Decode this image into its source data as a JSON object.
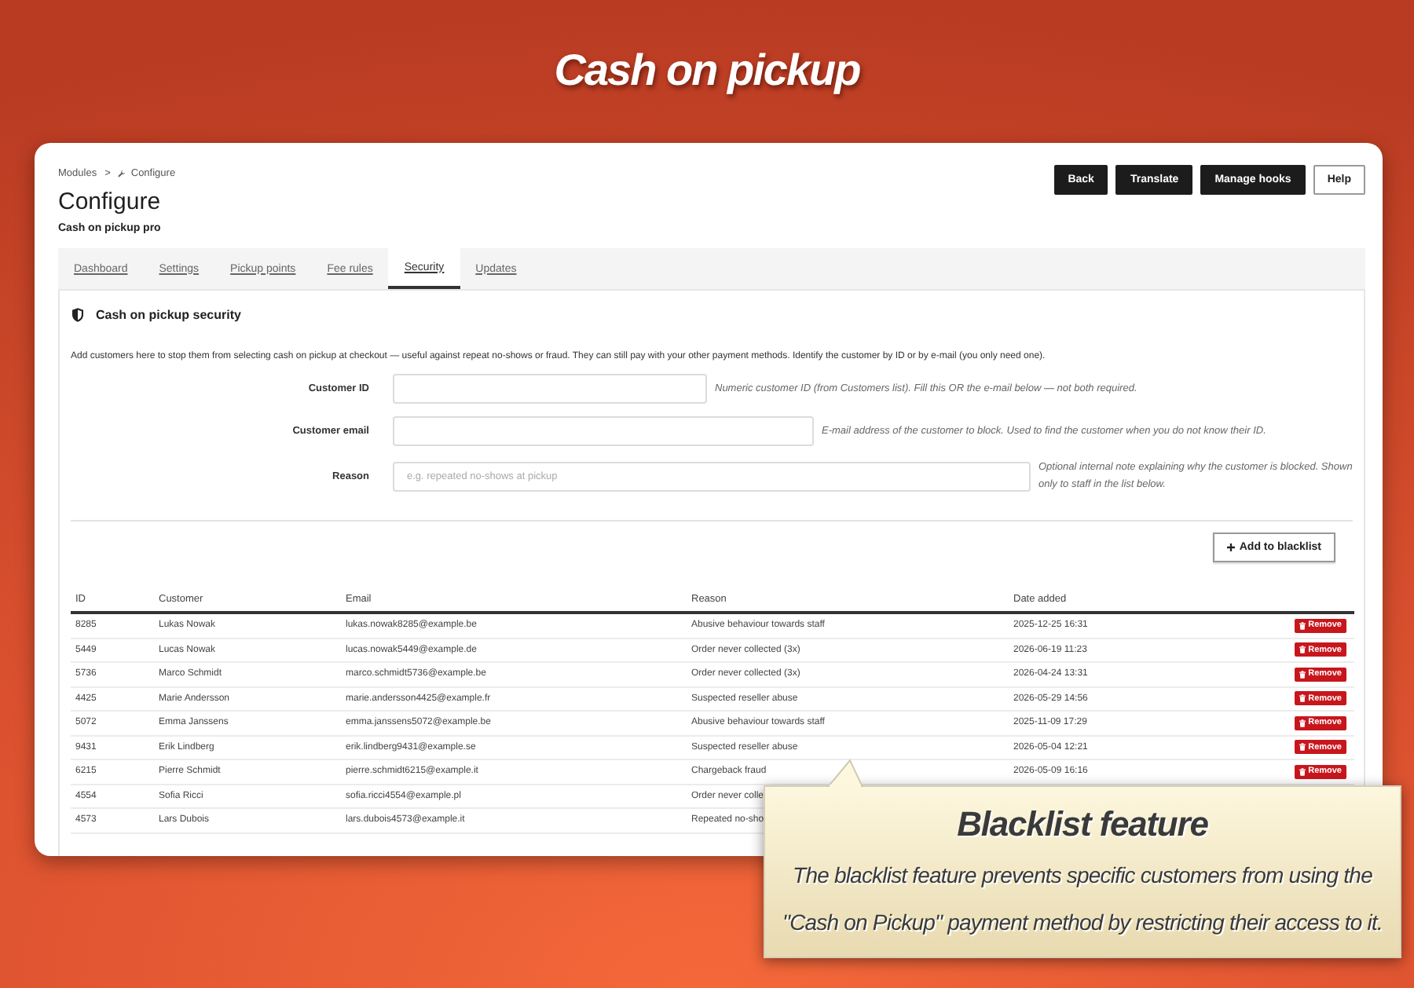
{
  "promo": {
    "title": "Cash on pickup"
  },
  "breadcrumb": {
    "items": [
      "Modules",
      "Configure"
    ],
    "separator": ">"
  },
  "page": {
    "title": "Configure",
    "subtitle": "Cash on pickup pro"
  },
  "header_buttons": [
    {
      "label": "Back",
      "kind": "dark"
    },
    {
      "label": "Translate",
      "kind": "dark"
    },
    {
      "label": "Manage hooks",
      "kind": "dark"
    },
    {
      "label": "Help",
      "kind": "outline"
    }
  ],
  "tabs": [
    {
      "label": "Dashboard",
      "selected": false
    },
    {
      "label": "Settings",
      "selected": false
    },
    {
      "label": "Pickup points",
      "selected": false
    },
    {
      "label": "Fee rules",
      "selected": false
    },
    {
      "label": "Security",
      "selected": true
    },
    {
      "label": "Updates",
      "selected": false
    }
  ],
  "panel": {
    "title": "Cash on pickup security",
    "description": "Add customers here to stop them from selecting cash on pickup at checkout — useful against repeat no-shows or fraud. They can still pay with your other payment methods. Identify the customer by ID or by e-mail (you only need one).",
    "fields": [
      {
        "label": "Customer ID",
        "help": "Numeric customer ID (from Customers list). Fill this OR the e-mail below — not both required."
      },
      {
        "label": "Customer email",
        "help": "E-mail address of the customer to block. Used to find the customer when you do not know their ID."
      },
      {
        "label": "Reason",
        "placeholder": "e.g. repeated no-shows at pickup",
        "help": "Optional internal note explaining why the customer is blocked. Shown only to staff in the list below."
      }
    ],
    "add_button": "Add to blacklist"
  },
  "table": {
    "columns": [
      "ID",
      "Customer",
      "Email",
      "Reason",
      "Date added"
    ],
    "rows": [
      {
        "id": "8285",
        "customer": "Lukas Nowak",
        "email": "lukas.nowak8285@example.be",
        "reason": "Abusive behaviour towards staff",
        "date_added": "2025-12-25 16:31",
        "action": "Remove"
      },
      {
        "id": "5449",
        "customer": "Lucas Nowak",
        "email": "lucas.nowak5449@example.de",
        "reason": "Order never collected (3x)",
        "date_added": "2026-06-19 11:23",
        "action": "Remove"
      },
      {
        "id": "5736",
        "customer": "Marco Schmidt",
        "email": "marco.schmidt5736@example.be",
        "reason": "Order never collected (3x)",
        "date_added": "2026-04-24 13:31",
        "action": "Remove"
      },
      {
        "id": "4425",
        "customer": "Marie Andersson",
        "email": "marie.andersson4425@example.fr",
        "reason": "Suspected reseller abuse",
        "date_added": "2026-05-29 14:56",
        "action": "Remove"
      },
      {
        "id": "5072",
        "customer": "Emma Janssens",
        "email": "emma.janssens5072@example.be",
        "reason": "Abusive behaviour towards staff",
        "date_added": "2025-11-09 17:29",
        "action": "Remove"
      },
      {
        "id": "9431",
        "customer": "Erik Lindberg",
        "email": "erik.lindberg9431@example.se",
        "reason": "Suspected reseller abuse",
        "date_added": "2026-05-04 12:21",
        "action": "Remove"
      },
      {
        "id": "6215",
        "customer": "Pierre Schmidt",
        "email": "pierre.schmidt6215@example.it",
        "reason": "Chargeback fraud",
        "date_added": "2026-05-09 16:16",
        "action": "Remove"
      },
      {
        "id": "4554",
        "customer": "Sofia Ricci",
        "email": "sofia.ricci4554@example.pl",
        "reason": "Order never colle"
      },
      {
        "id": "4573",
        "customer": "Lars Dubois",
        "email": "lars.dubois4573@example.it",
        "reason": "Repeated no-sho"
      }
    ]
  },
  "callout": {
    "title": "Blacklist feature",
    "text": "The blacklist feature prevents specific customers from using the \"Cash on Pickup\" payment method by restricting their access to it."
  }
}
